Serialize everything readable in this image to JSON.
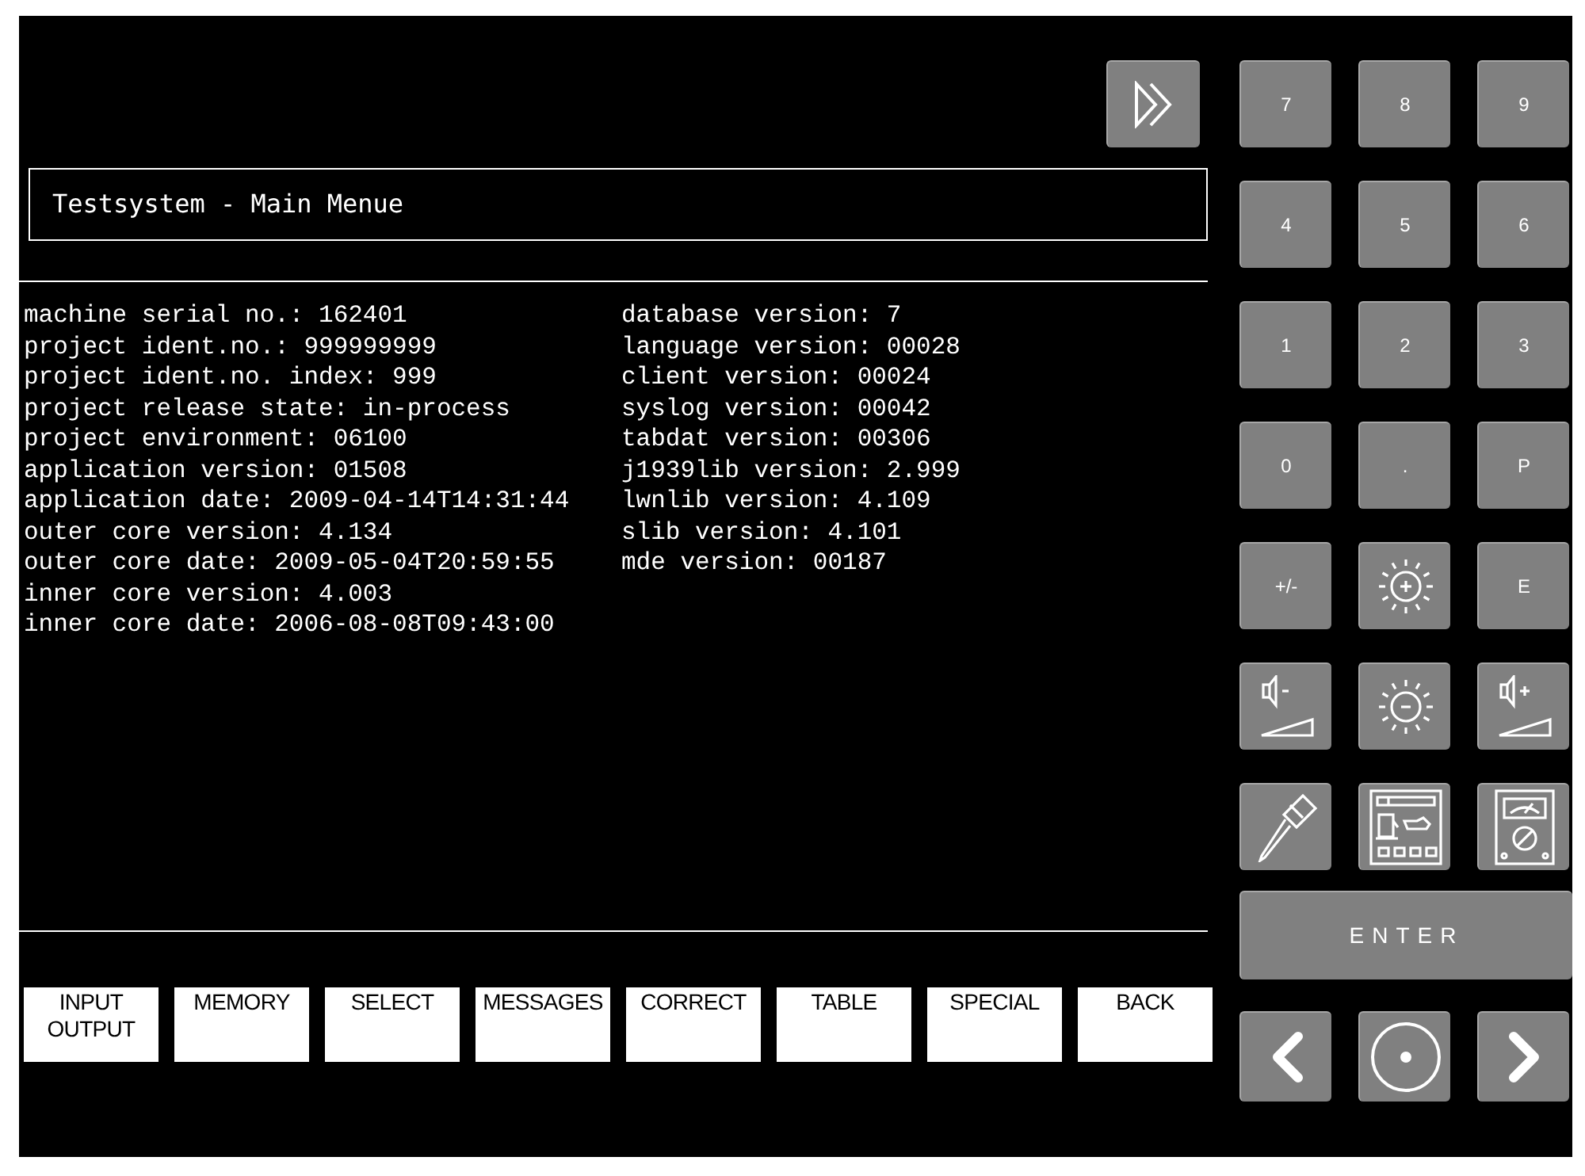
{
  "title": "Testsystem - Main Menue",
  "info_left": [
    "machine serial no.: 162401",
    "project ident.no.: 999999999",
    "project ident.no. index: 999",
    "project release state: in-process",
    "project environment: 06100",
    "application version: 01508",
    "application date: 2009-04-14T14:31:44",
    "outer core version: 4.134",
    "outer core date: 2009-05-04T20:59:55",
    "inner core version: 4.003",
    "inner core date: 2006-08-08T09:43:00"
  ],
  "info_right": [
    "database version: 7",
    "language version: 00028",
    "client version: 00024",
    "syslog version: 00042",
    "tabdat version: 00306",
    "j1939lib version: 2.999",
    "lwnlib version: 4.109",
    "slib version: 4.101",
    "mde version: 00187"
  ],
  "softkeys": [
    "INPUT OUTPUT",
    "MEMORY",
    "SELECT",
    "MESSAGES",
    "CORRECT",
    "TABLE",
    "SPECIAL",
    "BACK"
  ],
  "keypad": [
    {
      "kind": "key",
      "label": "7"
    },
    {
      "kind": "key",
      "label": "8"
    },
    {
      "kind": "key",
      "label": "9"
    },
    {
      "kind": "key",
      "label": "4"
    },
    {
      "kind": "key",
      "label": "5"
    },
    {
      "kind": "key",
      "label": "6"
    },
    {
      "kind": "key",
      "label": "1"
    },
    {
      "kind": "key",
      "label": "2"
    },
    {
      "kind": "key",
      "label": "3"
    },
    {
      "kind": "key",
      "label": "0"
    },
    {
      "kind": "key",
      "label": "."
    },
    {
      "kind": "key",
      "label": "P"
    },
    {
      "kind": "key",
      "label": "+/-"
    },
    {
      "kind": "brightness_up"
    },
    {
      "kind": "key",
      "label": "E"
    },
    {
      "kind": "volume_down"
    },
    {
      "kind": "brightness_down"
    },
    {
      "kind": "volume_up"
    },
    {
      "kind": "screwdriver"
    },
    {
      "kind": "machine_panel"
    },
    {
      "kind": "multimeter"
    }
  ],
  "enter": "ENTER",
  "nav": [
    {
      "kind": "left"
    },
    {
      "kind": "center"
    },
    {
      "kind": "right"
    }
  ]
}
